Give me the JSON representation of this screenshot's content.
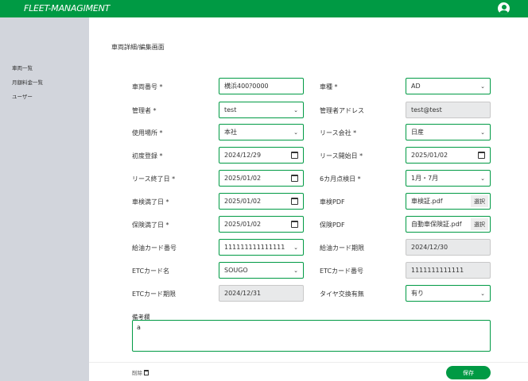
{
  "app": {
    "title": "FLEET-MANAGIMENT"
  },
  "sidebar": {
    "items": [
      {
        "label": "車両一覧"
      },
      {
        "label": "月額料金一覧"
      },
      {
        "label": "ユーザー"
      }
    ]
  },
  "page": {
    "title": "車両詳細/編集画面"
  },
  "form": {
    "vehicle_number": {
      "label": "車両番号 *",
      "value": "横浜400ｱ0000"
    },
    "vehicle_type": {
      "label": "車種 *",
      "value": "AD"
    },
    "manager": {
      "label": "管理者 *",
      "value": "test"
    },
    "manager_address": {
      "label": "管理者アドレス",
      "value": "test@test"
    },
    "location": {
      "label": "使用場所 *",
      "value": "本社"
    },
    "lease_company": {
      "label": "リース会社 *",
      "value": "日産"
    },
    "first_registration": {
      "label": "初度登録 *",
      "value": "2024/12/29"
    },
    "lease_start": {
      "label": "リース開始日 *",
      "value": "2025/01/02"
    },
    "lease_end": {
      "label": "リース終了日 *",
      "value": "2025/01/02"
    },
    "inspection_6m": {
      "label": "6カ月点検日 *",
      "value": "1月・7月"
    },
    "shaken_expiry": {
      "label": "車検満了日 *",
      "value": "2025/01/02"
    },
    "shaken_pdf": {
      "label": "車検PDF",
      "value": "車検証.pdf",
      "button": "選択"
    },
    "insurance_expiry": {
      "label": "保険満了日 *",
      "value": "2025/01/02"
    },
    "insurance_pdf": {
      "label": "保険PDF",
      "value": "自動車保険証.pdf",
      "button": "選択"
    },
    "fuel_card_number": {
      "label": "給油カード番号",
      "value": "111111111111111"
    },
    "fuel_card_expiry": {
      "label": "給油カード期限",
      "value": "2024/12/30"
    },
    "etc_card_name": {
      "label": "ETCカード名",
      "value": "SOUGO"
    },
    "etc_card_number": {
      "label": "ETCカード番号",
      "value": "1111111111111"
    },
    "etc_card_expiry": {
      "label": "ETCカード期限",
      "value": "2024/12/31"
    },
    "tire_change": {
      "label": "タイヤ交換有無",
      "value": "有り"
    },
    "memo": {
      "label": "備考欄",
      "value": "a"
    }
  },
  "footer": {
    "delete_label": "削除",
    "save_label": "保存"
  },
  "colors": {
    "brand": "#009a44",
    "sidebar_bg": "#d2d5dc",
    "readonly_bg": "#e8e9ea"
  },
  "icons": [
    "user-account-icon",
    "chevron-down-icon",
    "calendar-icon",
    "trash-icon"
  ]
}
